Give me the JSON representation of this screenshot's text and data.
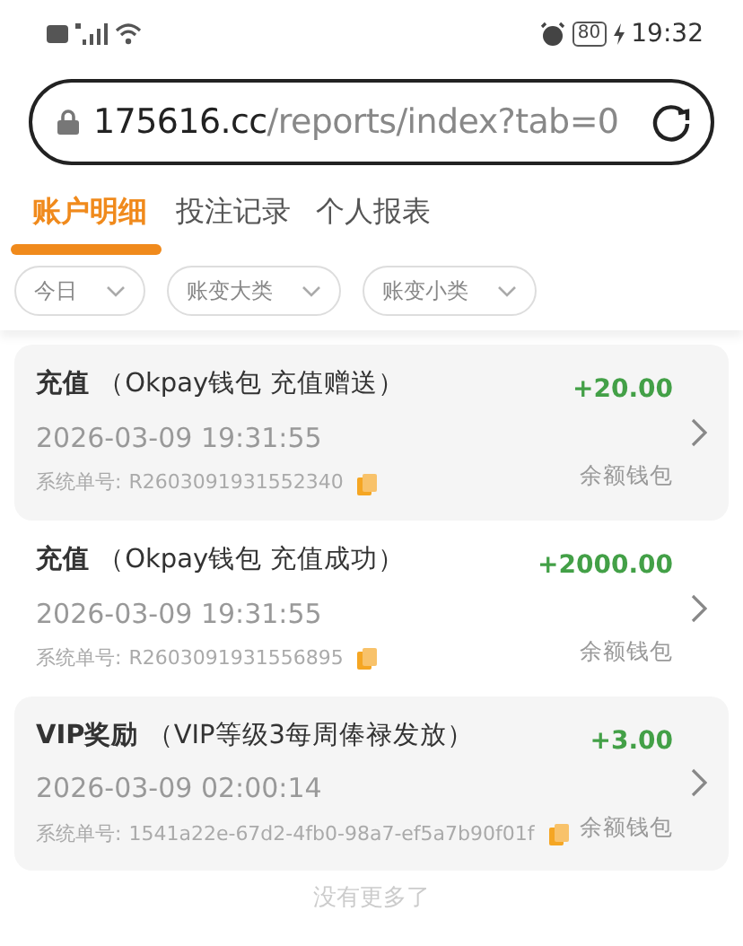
{
  "status_bar": {
    "battery": "80",
    "time": "19:32"
  },
  "address_bar": {
    "host": "175616.cc",
    "path": "/reports/index?tab=0"
  },
  "tabs": [
    {
      "label": "账户明细",
      "selected": true
    },
    {
      "label": "投注记录",
      "selected": false
    },
    {
      "label": "个人报表",
      "selected": false
    }
  ],
  "filters": [
    {
      "label": "今日"
    },
    {
      "label": "账变大类"
    },
    {
      "label": "账变小类"
    }
  ],
  "records": [
    {
      "title": "**充值** （Okpay钱包 充值赠送）",
      "time": "2026-03-09 19:31:55",
      "order_label": "系统单号:",
      "order_no": "R2603091931552340",
      "amount": "+20.00",
      "wallet": "余额钱包"
    },
    {
      "title": "**充值** （Okpay钱包 充值成功）",
      "time": "2026-03-09 19:31:55",
      "order_label": "系统单号:",
      "order_no": "R2603091931556895",
      "amount": "+2000.00",
      "wallet": "余额钱包"
    },
    {
      "title": "**VIP奖励** （VIP等级3每周俸禄发放）",
      "time": "2026-03-09 02:00:14",
      "order_label": "系统单号:",
      "order_no": "1541a22e-67d2-4fb0-98a7-ef5a7b90f01f",
      "amount": "+3.00",
      "wallet": "余额钱包"
    }
  ],
  "footer": "没有更多了"
}
